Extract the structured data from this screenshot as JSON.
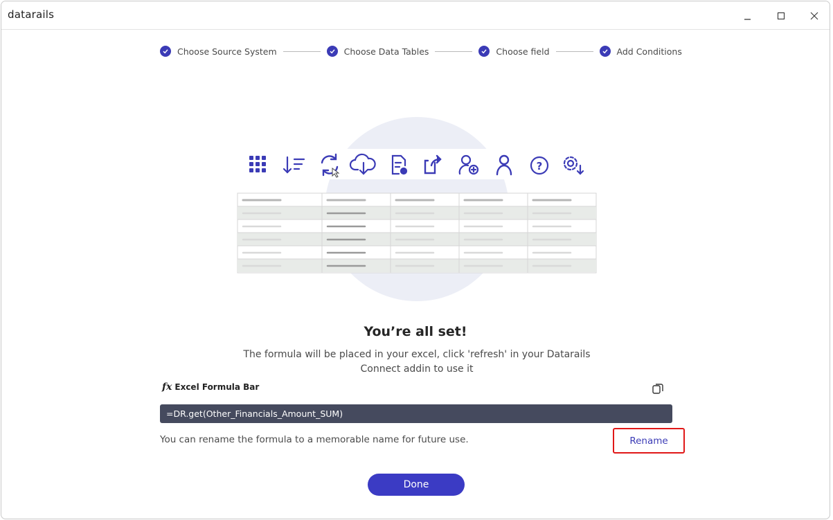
{
  "app": {
    "logo": "datarails"
  },
  "window_controls": {
    "minimize": "minimize",
    "maximize": "maximize",
    "close": "close"
  },
  "stepper": {
    "steps": [
      {
        "label": "Choose Source System",
        "status": "completed"
      },
      {
        "label": "Choose Data Tables",
        "status": "completed"
      },
      {
        "label": "Choose field",
        "status": "completed"
      },
      {
        "label": "Add Conditions",
        "status": "completed"
      }
    ]
  },
  "illustration": {
    "toolbar_icons": [
      "grid-icon",
      "sort-icon",
      "refresh-icon",
      "cloud-download-icon",
      "document-settings-icon",
      "share-icon",
      "user-add-icon",
      "user-icon",
      "help-icon",
      "settings-icon"
    ]
  },
  "main": {
    "heading": "You’re all set!",
    "description": "The formula will be placed in your excel, click 'refresh' in your Datarails Connect addin to use it",
    "formula_bar_label": "Excel Formula Bar",
    "formula": "=DR.get(Other_Financials_Amount_SUM)",
    "rename_note": "You can rename the formula to a memorable name for future use.",
    "rename_label": "Rename",
    "done_label": "Done"
  },
  "colors": {
    "accent": "#3b3bc4",
    "highlight": "#e01717",
    "formula_bg": "#454a5e"
  }
}
